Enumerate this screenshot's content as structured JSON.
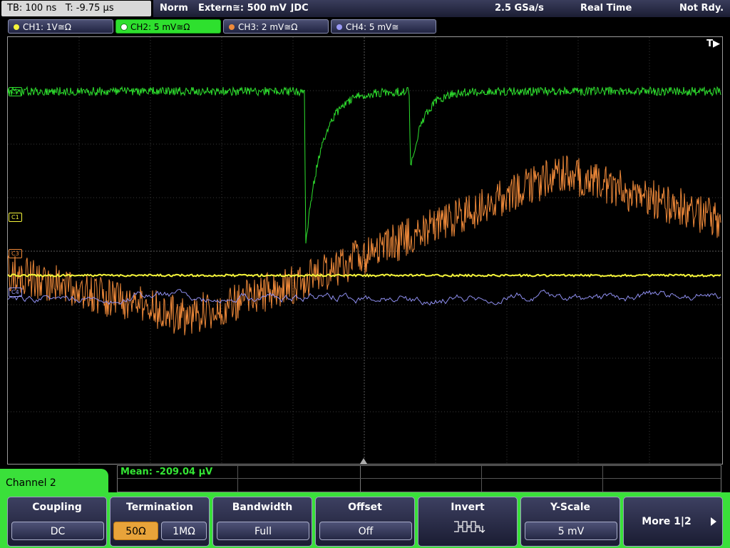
{
  "topbar": {
    "timebase": "TB: 100 ns",
    "trigger_time": "T: -9.75 µs",
    "mode": "Norm",
    "trigger_source": "Extern≅: 500 mV ⌋DC",
    "sample_rate": "2.5 GSa/s",
    "acquisition": "Real Time",
    "status": "Not Rdy."
  },
  "channels": [
    {
      "label": "CH1: 1V≅Ω",
      "color": "#f5f53a"
    },
    {
      "label": "CH2: 5 mV≅Ω",
      "color": "#2ee02e"
    },
    {
      "label": "CH3: 2 mV≅Ω",
      "color": "#f08a3a"
    },
    {
      "label": "CH4: 5 mV≅",
      "color": "#9a9af5"
    }
  ],
  "markers": {
    "c1": "C1",
    "c2": "C2",
    "c3": "C3",
    "c4": "C4"
  },
  "trigger_flag": "T▶",
  "measurement": {
    "mean": "Mean: -209.04 µV"
  },
  "menu": {
    "title": "Channel 2",
    "coupling": {
      "title": "Coupling",
      "value": "DC"
    },
    "termination": {
      "title": "Termination",
      "opt1": "50Ω",
      "opt2": "1MΩ"
    },
    "bandwidth": {
      "title": "Bandwidth",
      "value": "Full"
    },
    "offset": {
      "title": "Offset",
      "value": "Off"
    },
    "invert": {
      "title": "Invert"
    },
    "yscale": {
      "title": "Y-Scale",
      "value": "5 mV"
    },
    "more": {
      "label": "More 1|2"
    }
  }
}
